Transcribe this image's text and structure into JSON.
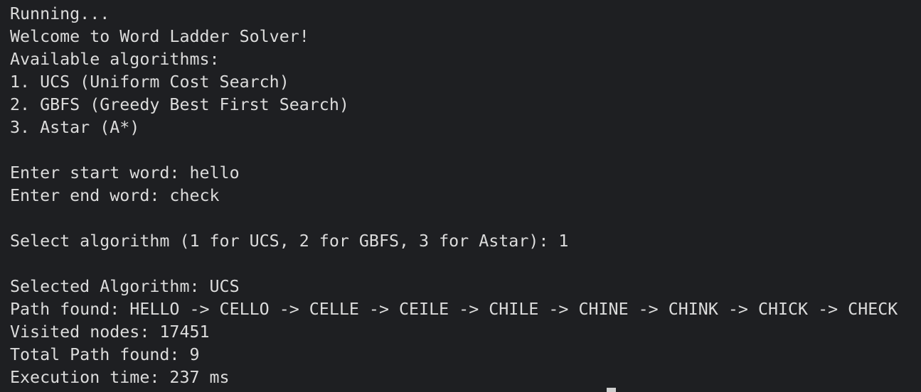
{
  "terminal": {
    "lines": [
      "Running...",
      "Welcome to Word Ladder Solver!",
      "Available algorithms:",
      "1. UCS (Uniform Cost Search)",
      "2. GBFS (Greedy Best First Search)",
      "3. Astar (A*)",
      "",
      "Enter start word: hello",
      "Enter end word: check",
      "",
      "Select algorithm (1 for UCS, 2 for GBFS, 3 for Astar): 1",
      "",
      "Selected Algorithm: UCS",
      "Path found: HELLO -> CELLO -> CELLE -> CEILE -> CHILE -> CHINE -> CHINK -> CHICK -> CHECK",
      "Visited nodes: 17451",
      "Total Path found: 9",
      "Execution time: 237 ms"
    ]
  },
  "colors": {
    "background": "#1e1f22",
    "text": "#dcdcdc",
    "cursor": "#cfcfcf"
  }
}
